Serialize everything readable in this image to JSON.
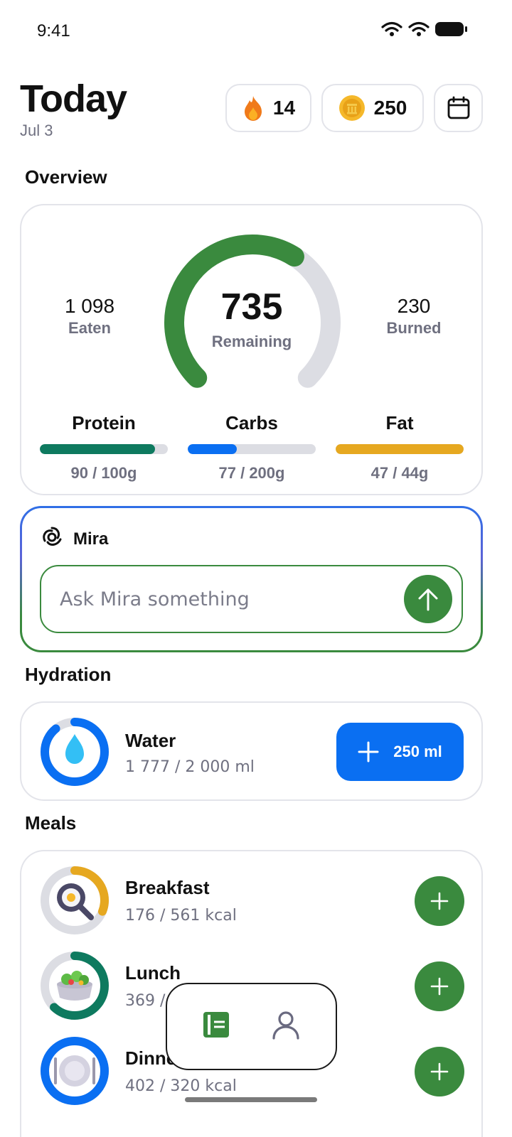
{
  "status_bar": {
    "time": "9:41"
  },
  "header": {
    "title": "Today",
    "date": "Jul 3",
    "streak": "14",
    "coins": "250"
  },
  "overview": {
    "section_title": "Overview",
    "eaten_value": "1 098",
    "eaten_label": "Eaten",
    "remaining_value": "735",
    "remaining_label": "Remaining",
    "burned_value": "230",
    "burned_label": "Burned",
    "calorie_progress": 0.62,
    "macros": [
      {
        "name": "Protein",
        "value": "90 / 100g",
        "progress": 0.9,
        "color": "#0e7a5f"
      },
      {
        "name": "Carbs",
        "value": "77 / 200g",
        "progress": 0.385,
        "color": "#0a6ff2"
      },
      {
        "name": "Fat",
        "value": "47 / 44g",
        "progress": 1.0,
        "color": "#e6a820"
      }
    ]
  },
  "mira": {
    "name": "Mira",
    "placeholder": "Ask Mira something"
  },
  "hydration": {
    "section_title": "Hydration",
    "title": "Water",
    "value": "1 777 / 2 000 ml",
    "progress": 0.89,
    "add_label": "250 ml"
  },
  "meals": {
    "section_title": "Meals",
    "items": [
      {
        "name": "Breakfast",
        "value": "176 / 561 kcal",
        "progress": 0.31,
        "color": "#e6a820"
      },
      {
        "name": "Lunch",
        "value": "369 / 600 kcal",
        "progress": 0.62,
        "color": "#0e7a5f"
      },
      {
        "name": "Dinner",
        "value": "402 / 320 kcal",
        "progress": 1.0,
        "color": "#0a6ff2"
      }
    ]
  },
  "colors": {
    "accent_green": "#3a8a3e",
    "accent_blue": "#0a6ff2",
    "track_gray": "#dcdde3",
    "muted_text": "#6f7080"
  }
}
